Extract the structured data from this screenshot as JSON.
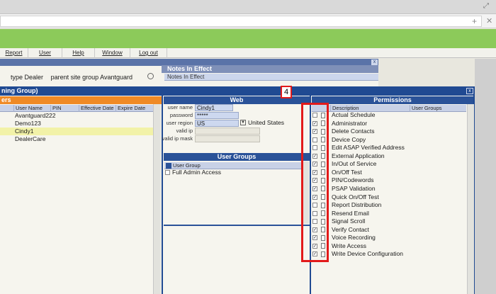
{
  "menu": [
    "Report",
    "User",
    "Help",
    "Window",
    "Log out"
  ],
  "background_window": {
    "type_label": "type",
    "type_value": "Dealer",
    "site_group_label": "parent site group",
    "site_group_value": "Avantguard",
    "notes_header": "Notes In Effect",
    "notes_sub": "Notes In Effect"
  },
  "main_window": {
    "title": "ning Group)",
    "close_label": "x",
    "annotation_number": "4"
  },
  "users_panel": {
    "header": "ers",
    "columns": [
      "User Name",
      "PIN",
      "Effective Date",
      "Expire Date"
    ],
    "rows": [
      "Avantguard222",
      "Demo123",
      "Cindy1",
      "DealerCare"
    ],
    "selected": "Cindy1"
  },
  "web_panel": {
    "header": "Web",
    "fields": {
      "user_name_label": "user name",
      "user_name_value": "Cindy1",
      "password_label": "password",
      "password_value": "*****",
      "user_region_label": "user region",
      "user_region_value": "US",
      "user_region_country": "United States",
      "valid_ip_label": "valid ip",
      "valid_ip_mask_label": "valid ip mask"
    }
  },
  "user_groups_panel": {
    "header": "User Groups",
    "column": "User Group",
    "rows": [
      {
        "label": "Full Admin Access",
        "checked": false
      }
    ]
  },
  "permissions_panel": {
    "header": "Permissions",
    "columns": [
      "Description",
      "User Groups"
    ],
    "rows": [
      {
        "label": "Actual Schedule",
        "checked": false
      },
      {
        "label": "Administrator",
        "checked": true
      },
      {
        "label": "Delete Contacts",
        "checked": true
      },
      {
        "label": "Device Copy",
        "checked": false
      },
      {
        "label": "Edit ASAP Verified Address",
        "checked": false
      },
      {
        "label": "External Application",
        "checked": true
      },
      {
        "label": "In/Out of Service",
        "checked": true
      },
      {
        "label": "On/Off Test",
        "checked": true
      },
      {
        "label": "PIN/Codewords",
        "checked": true
      },
      {
        "label": "PSAP Validation",
        "checked": true
      },
      {
        "label": "Quick On/Off Test",
        "checked": true
      },
      {
        "label": "Report Distribution",
        "checked": false
      },
      {
        "label": "Resend Email",
        "checked": false
      },
      {
        "label": "Signal Scroll",
        "checked": false
      },
      {
        "label": "Verify Contact",
        "checked": true
      },
      {
        "label": "Voice Recording",
        "checked": true
      },
      {
        "label": "Write Access",
        "checked": true
      },
      {
        "label": "Write Device Configuration",
        "checked": true
      }
    ]
  },
  "colors": {
    "accent_green": "#8cca5a",
    "title_blue": "#204a92",
    "orange_header": "#ef8a26",
    "annotation_red": "#e21a1a"
  }
}
